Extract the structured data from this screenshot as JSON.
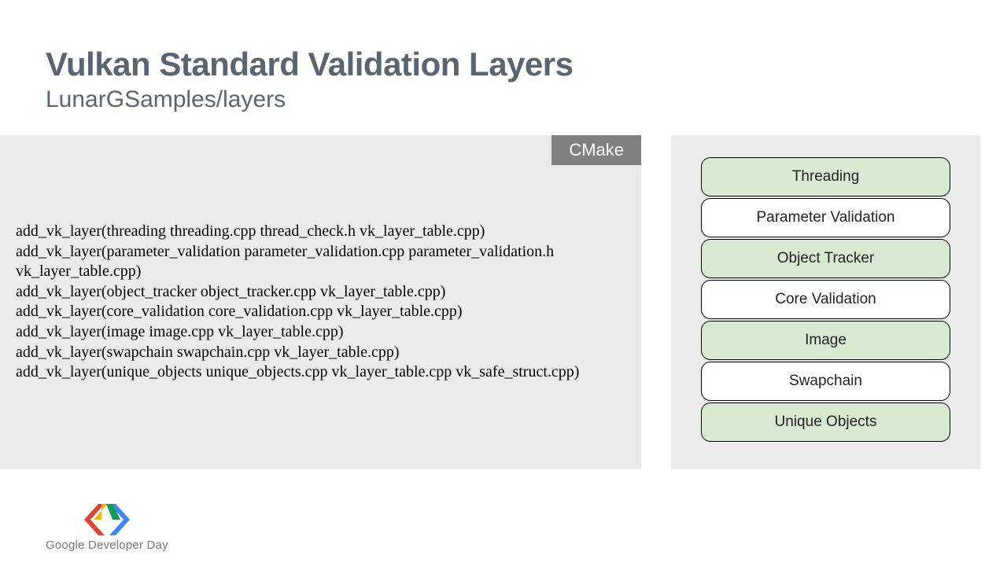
{
  "header": {
    "title": "Vulkan Standard Validation Layers",
    "subtitle": "LunarGSamples/layers"
  },
  "code_panel": {
    "badge": "CMake",
    "lines": [
      "add_vk_layer(threading threading.cpp thread_check.h vk_layer_table.cpp)",
      "add_vk_layer(parameter_validation parameter_validation.cpp parameter_validation.h",
      "vk_layer_table.cpp)",
      "add_vk_layer(object_tracker object_tracker.cpp vk_layer_table.cpp)",
      "add_vk_layer(core_validation core_validation.cpp vk_layer_table.cpp)",
      "add_vk_layer(image image.cpp vk_layer_table.cpp)",
      "add_vk_layer(swapchain swapchain.cpp vk_layer_table.cpp)",
      "add_vk_layer(unique_objects unique_objects.cpp vk_layer_table.cpp vk_safe_struct.cpp)"
    ]
  },
  "layers": [
    {
      "label": "Threading",
      "style": "green"
    },
    {
      "label": "Parameter Validation",
      "style": "white"
    },
    {
      "label": "Object Tracker",
      "style": "green"
    },
    {
      "label": "Core Validation",
      "style": "white"
    },
    {
      "label": "Image",
      "style": "green"
    },
    {
      "label": "Swapchain",
      "style": "white"
    },
    {
      "label": "Unique Objects",
      "style": "green"
    }
  ],
  "footer": {
    "brand": "Google",
    "event1": "Developer",
    "event2": "Day",
    "colors": {
      "red": "#db4437",
      "yellow": "#f4b400",
      "blue": "#4285f4",
      "green": "#0f9d58"
    }
  }
}
